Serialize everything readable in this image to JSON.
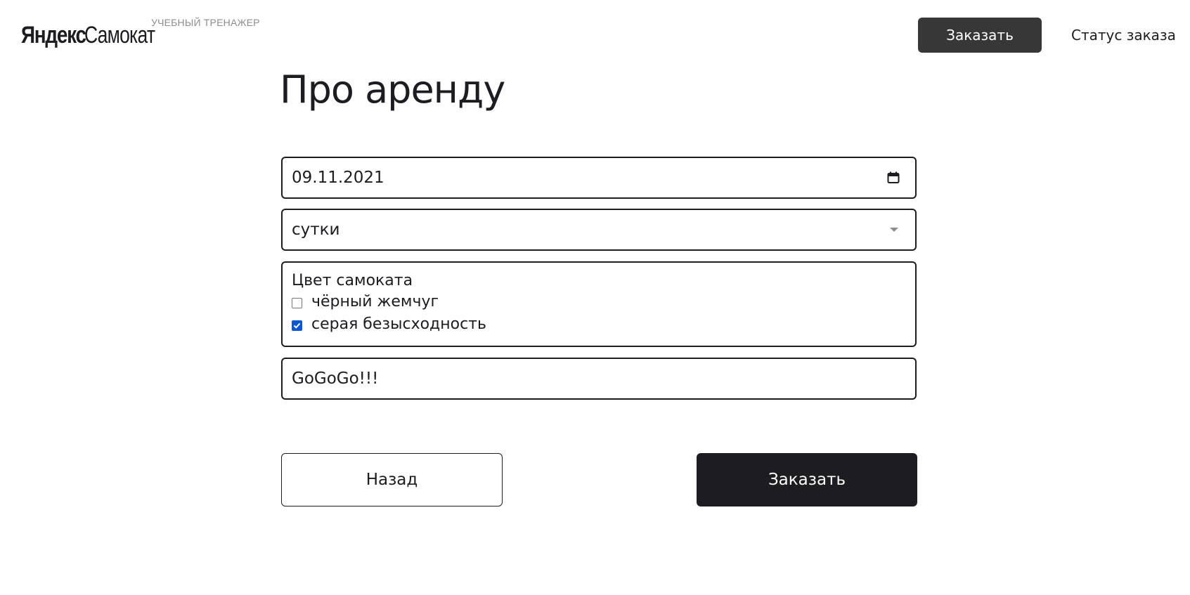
{
  "header": {
    "logo_yandex": "Яндекс",
    "logo_samokat": "Самокат",
    "logo_subtitle": "УЧЕБНЫЙ ТРЕНАЖЕР",
    "order_button": "Заказать",
    "status_link": "Статус заказа"
  },
  "page": {
    "title": "Про аренду"
  },
  "form": {
    "date_value": "09.11.2021",
    "period_value": "сутки",
    "color_label": "Цвет самоката",
    "colors": [
      {
        "label": "чёрный жемчуг",
        "checked": false
      },
      {
        "label": "серая безысходность",
        "checked": true
      }
    ],
    "comment_value": "GoGoGo!!!"
  },
  "actions": {
    "back": "Назад",
    "submit": "Заказать"
  },
  "colors": {
    "header_button_bg": "#373737",
    "primary_bg": "#1c1c21",
    "checkbox_accent": "#0b57d0",
    "muted_text": "#8d8d8d"
  }
}
